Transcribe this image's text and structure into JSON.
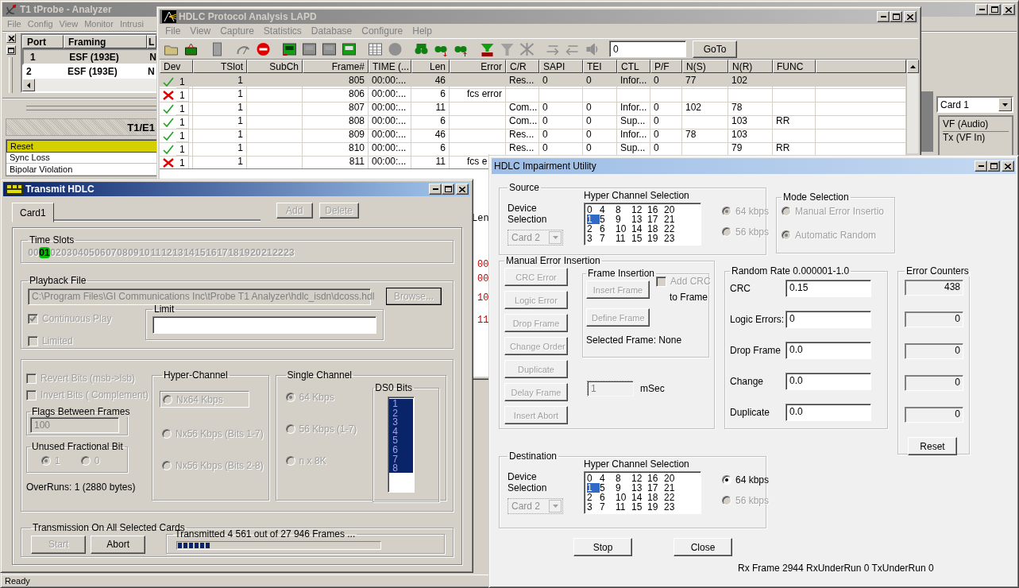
{
  "analyzer": {
    "title": "T1 tProbe - Analyzer",
    "active": false,
    "menu": [
      "File",
      "Config",
      "View",
      "Monitor",
      "Intrusi"
    ],
    "port_table": {
      "columns": [
        "Port",
        "Framing",
        "L"
      ],
      "rows": [
        {
          "cells": [
            "1",
            "ESF (193E)",
            "N"
          ],
          "selected": true
        },
        {
          "cells": [
            "2",
            "ESF (193E)",
            "N"
          ],
          "selected": false
        }
      ]
    },
    "panel_title": "T1/E1",
    "alarms": [
      {
        "label": "Reset",
        "highlighted": true
      },
      {
        "label": "Sync Loss",
        "highlighted": false
      },
      {
        "label": "Bipolar Violation",
        "highlighted": false
      }
    ],
    "card_select": "Card 1",
    "groups": [
      "VF (Audio)",
      "Tx (VF In)"
    ],
    "status": "Ready"
  },
  "protocol": {
    "title": "HDLC Protocol Analysis LAPD",
    "active": false,
    "menu": [
      "File",
      "View",
      "Capture",
      "Statistics",
      "Database",
      "Configure",
      "Help"
    ],
    "goto_value": "0",
    "goto_button": "GoTo",
    "columns": [
      "Dev",
      "TSlot",
      "SubCh",
      "Frame#",
      "TIME (...",
      "Len",
      "Error",
      "C/R",
      "SAPI",
      "TEI",
      "CTL",
      "P/F",
      "N(S)",
      "N(R)",
      "FUNC"
    ],
    "rows": [
      {
        "kind": "ok",
        "selected": true,
        "cells": [
          "1",
          "1",
          null,
          "805",
          "00:00:...",
          "46",
          null,
          "Res...",
          "0",
          "0",
          "Infor...",
          "0",
          "77",
          "102",
          null
        ]
      },
      {
        "kind": "error",
        "selected": false,
        "cells": [
          "1",
          "1",
          null,
          "806",
          "00:00:...",
          "6",
          "fcs error",
          null,
          null,
          null,
          null,
          null,
          null,
          null,
          null
        ]
      },
      {
        "kind": "ok",
        "selected": false,
        "cells": [
          "1",
          "1",
          null,
          "807",
          "00:00:...",
          "11",
          null,
          "Com...",
          "0",
          "0",
          "Infor...",
          "0",
          "102",
          "78",
          null
        ]
      },
      {
        "kind": "ok",
        "selected": false,
        "cells": [
          "1",
          "1",
          null,
          "808",
          "00:00:...",
          "6",
          null,
          "Com...",
          "0",
          "0",
          "Sup...",
          "0",
          null,
          "103",
          "RR"
        ]
      },
      {
        "kind": "ok",
        "selected": false,
        "cells": [
          "1",
          "1",
          null,
          "809",
          "00:00:...",
          "46",
          null,
          "Res...",
          "0",
          "0",
          "Infor...",
          "0",
          "78",
          "103",
          null
        ]
      },
      {
        "kind": "ok",
        "selected": false,
        "cells": [
          "1",
          "1",
          null,
          "810",
          "00:00:...",
          "6",
          null,
          "Res...",
          "0",
          "0",
          "Sup...",
          "0",
          null,
          "79",
          "RR"
        ]
      },
      {
        "kind": "error",
        "selected": false,
        "cells": [
          "1",
          "1",
          null,
          "811",
          "00:00:...",
          "11",
          "fcs e"
        ]
      }
    ],
    "detail_lines": [
      {
        "text": "Len",
        "color": "#000000"
      },
      {
        "text": "00",
        "color": "#c00000"
      },
      {
        "text": "00",
        "color": "#c00000"
      },
      {
        "text": "10",
        "color": "#c00000"
      },
      {
        "text": "11",
        "color": "#c00000"
      }
    ]
  },
  "transmit": {
    "title": "Transmit HDLC",
    "active": true,
    "tabs": [
      {
        "label": "Card1",
        "selected": true
      }
    ],
    "buttons": [
      {
        "label": "Add",
        "disabled": true
      },
      {
        "label": "Delete",
        "disabled": true
      }
    ],
    "time_slots": {
      "label": "Time Slots",
      "slots": [
        {
          "label": "00",
          "selected": false
        },
        {
          "label": "01",
          "selected": true
        },
        {
          "label": "02",
          "selected": false
        },
        {
          "label": "03",
          "selected": false
        },
        {
          "label": "04",
          "selected": false
        },
        {
          "label": "05",
          "selected": false
        },
        {
          "label": "06",
          "selected": false
        },
        {
          "label": "07",
          "selected": false
        },
        {
          "label": "08",
          "selected": false
        },
        {
          "label": "09",
          "selected": false
        },
        {
          "label": "10",
          "selected": false
        },
        {
          "label": "11",
          "selected": false
        },
        {
          "label": "12",
          "selected": false
        },
        {
          "label": "13",
          "selected": false
        },
        {
          "label": "14",
          "selected": false
        },
        {
          "label": "15",
          "selected": false
        },
        {
          "label": "16",
          "selected": false
        },
        {
          "label": "17",
          "selected": false
        },
        {
          "label": "18",
          "selected": false
        },
        {
          "label": "19",
          "selected": false
        },
        {
          "label": "20",
          "selected": false
        },
        {
          "label": "21",
          "selected": false
        },
        {
          "label": "22",
          "selected": false
        },
        {
          "label": "23",
          "selected": false
        }
      ]
    },
    "playback": {
      "label": "Playback File",
      "path": "C:\\Program Files\\GI Communications Inc\\tProbe T1 Analyzer\\hdlc_isdn\\dcoss.hdl",
      "browse": {
        "label": "Browse...",
        "disabled": true
      },
      "checkboxes": [
        {
          "label": "Continuous Play",
          "checked": true,
          "disabled": true
        },
        {
          "label": "Limited",
          "checked": false,
          "disabled": true
        }
      ],
      "limit_label": "Limit"
    },
    "options": {
      "checkboxes": [
        {
          "label": "Revert Bits (msb->lsb)",
          "checked": false,
          "disabled": true
        },
        {
          "label": "Invert Bits ( Complement)",
          "checked": false,
          "disabled": true
        }
      ],
      "flags_label": "Flags Between Frames",
      "flags_value": "100",
      "fraction_label": "Unused Fractional Bit",
      "fraction_radios": [
        {
          "label": "1",
          "selected": true,
          "disabled": true
        },
        {
          "label": "0",
          "selected": false,
          "disabled": true
        }
      ],
      "overruns": "OverRuns: 1 (2880 bytes)"
    },
    "hyper": {
      "label": "Hyper-Channel",
      "radios": [
        {
          "label": "Nx64 Kbps",
          "selected": false,
          "disabled": true
        },
        {
          "label": "Nx56 Kbps (Bits 1-7)",
          "selected": false,
          "disabled": true
        },
        {
          "label": "Nx56 Kbps (Bits 2-8)",
          "selected": false,
          "disabled": true
        }
      ]
    },
    "single": {
      "label": "Single Channel",
      "radios": [
        {
          "label": "64 Kbps",
          "selected": true,
          "disabled": true
        },
        {
          "label": "56 Kbps (1-7)",
          "selected": false,
          "disabled": true
        },
        {
          "label": "n x 8K",
          "selected": false,
          "disabled": true
        }
      ],
      "bits_label": "DS0 Bits",
      "bits": [
        {
          "label": "1",
          "selected": true
        },
        {
          "label": "2",
          "selected": true
        },
        {
          "label": "3",
          "selected": true
        },
        {
          "label": "4",
          "selected": true
        },
        {
          "label": "5",
          "selected": true
        },
        {
          "label": "6",
          "selected": true
        },
        {
          "label": "7",
          "selected": true
        },
        {
          "label": "8",
          "selected": true
        }
      ]
    },
    "transmission": {
      "label": "Transmission On All Selected Cards",
      "buttons": [
        {
          "label": "Start",
          "disabled": true
        },
        {
          "label": "Abort",
          "disabled": false
        }
      ],
      "progress_label": "Transmitted 4 561 out of 27 946 Frames ...",
      "level": 0.16
    }
  },
  "impairment": {
    "title": "HDLC Impairment Utility",
    "active": false,
    "source": {
      "label": "Source",
      "device_label": "Device Selection",
      "device": "Card 2",
      "device_disabled": true,
      "channels_label": "Hyper Channel Selection",
      "channels": [
        {
          "label": "0",
          "selected": false
        },
        {
          "label": "1",
          "selected": true
        },
        {
          "label": "2",
          "selected": false
        },
        {
          "label": "3",
          "selected": false
        },
        {
          "label": "4",
          "selected": false
        },
        {
          "label": "5",
          "selected": false
        },
        {
          "label": "6",
          "selected": false
        },
        {
          "label": "7",
          "selected": false
        },
        {
          "label": "8",
          "selected": false
        },
        {
          "label": "9",
          "selected": false
        },
        {
          "label": "10",
          "selected": false
        },
        {
          "label": "11",
          "selected": false
        },
        {
          "label": "12",
          "selected": false
        },
        {
          "label": "13",
          "selected": false
        },
        {
          "label": "14",
          "selected": false
        },
        {
          "label": "15",
          "selected": false
        },
        {
          "label": "16",
          "selected": false
        },
        {
          "label": "17",
          "selected": false
        },
        {
          "label": "18",
          "selected": false
        },
        {
          "label": "19",
          "selected": false
        },
        {
          "label": "20",
          "selected": false
        },
        {
          "label": "21",
          "selected": false
        },
        {
          "label": "22",
          "selected": false
        },
        {
          "label": "23",
          "selected": false
        }
      ],
      "radios": [
        {
          "label": "64 kbps",
          "selected": true,
          "disabled": true
        },
        {
          "label": "56 kbps",
          "selected": false,
          "disabled": true
        }
      ]
    },
    "mode": {
      "label": "Mode Selection",
      "radios": [
        {
          "label": "Manual Error Insertio",
          "selected": false,
          "disabled": true
        },
        {
          "label": "Automatic Random",
          "selected": true,
          "disabled": true
        }
      ]
    },
    "manual": {
      "label": "Manual Error Insertion",
      "buttons": [
        {
          "label": "CRC Error",
          "disabled": true
        },
        {
          "label": "Logic Error",
          "disabled": true
        },
        {
          "label": "Drop Frame",
          "disabled": true
        },
        {
          "label": "Change Order",
          "disabled": true
        },
        {
          "label": "Duplicate",
          "disabled": true
        },
        {
          "label": "Delay Frame",
          "disabled": true
        },
        {
          "label": "Insert Abort",
          "disabled": true
        }
      ],
      "frame_label": "Frame Insertion",
      "frame_buttons": [
        {
          "label": "Insert Frame",
          "disabled": true
        },
        {
          "label": "Define Frame",
          "disabled": true
        }
      ],
      "add_crc": {
        "label": "Add CRC",
        "checked": false,
        "disabled": true
      },
      "to_frame": "to Frame",
      "selected_frame": "Selected Frame: None",
      "delay_value": "1",
      "delay_disabled": true,
      "delay_unit": "mSec"
    },
    "random": {
      "label": "Random Rate 0.000001-1.0",
      "rows": [
        {
          "label": "CRC",
          "value": "0.15"
        },
        {
          "label": "Logic Errors:",
          "value": "0"
        },
        {
          "label": "Drop Frame",
          "value": "0.0"
        },
        {
          "label": "Change",
          "value": "0.0"
        },
        {
          "label": "Duplicate",
          "value": "0.0"
        }
      ]
    },
    "counters": {
      "label": "Error Counters",
      "values": [
        "438",
        "0",
        "0",
        "0",
        "0"
      ],
      "reset": "Reset"
    },
    "destination": {
      "label": "Destination",
      "device_label": "Device Selection",
      "device": "Card 2",
      "device_disabled": true,
      "channels_label": "Hyper Channel Selection",
      "channels": [
        {
          "label": "0",
          "selected": false
        },
        {
          "label": "1",
          "selected": true
        },
        {
          "label": "2",
          "selected": false
        },
        {
          "label": "3",
          "selected": false
        },
        {
          "label": "4",
          "selected": false
        },
        {
          "label": "5",
          "selected": false
        },
        {
          "label": "6",
          "selected": false
        },
        {
          "label": "7",
          "selected": false
        },
        {
          "label": "8",
          "selected": false
        },
        {
          "label": "9",
          "selected": false
        },
        {
          "label": "10",
          "selected": false
        },
        {
          "label": "11",
          "selected": false
        },
        {
          "label": "12",
          "selected": false
        },
        {
          "label": "13",
          "selected": false
        },
        {
          "label": "14",
          "selected": false
        },
        {
          "label": "15",
          "selected": false
        },
        {
          "label": "16",
          "selected": false
        },
        {
          "label": "17",
          "selected": false
        },
        {
          "label": "18",
          "selected": false
        },
        {
          "label": "19",
          "selected": false
        },
        {
          "label": "20",
          "selected": false
        },
        {
          "label": "21",
          "selected": false
        },
        {
          "label": "22",
          "selected": false
        },
        {
          "label": "23",
          "selected": false
        }
      ],
      "radios": [
        {
          "label": "64 kbps",
          "selected": true,
          "disabled": false
        },
        {
          "label": "56 kbps",
          "selected": false,
          "disabled": true
        }
      ]
    },
    "buttons": [
      "Stop",
      "Close"
    ],
    "status": "Rx Frame 2944 RxUnderRun 0 TxUnderRun 0"
  }
}
